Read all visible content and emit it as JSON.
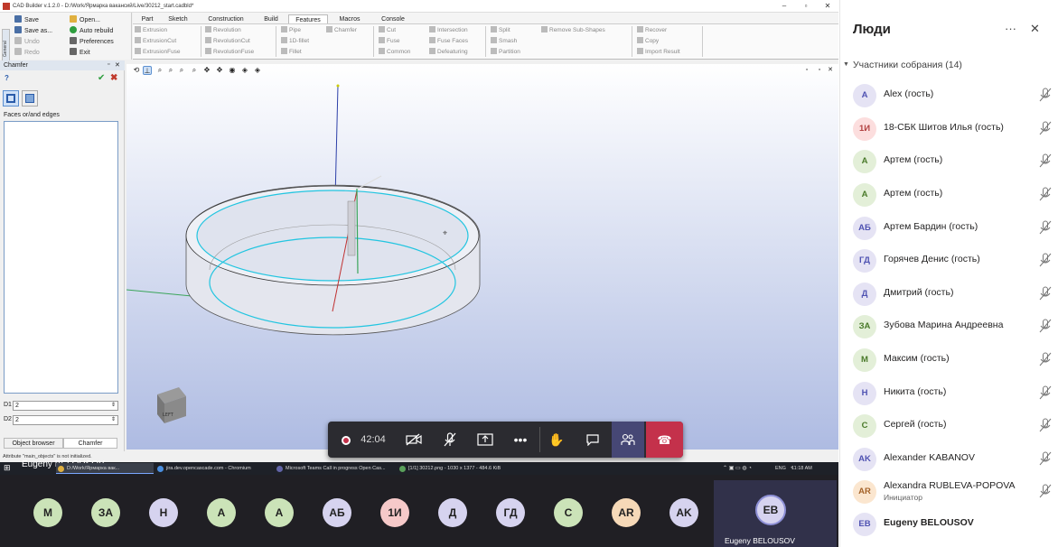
{
  "cad": {
    "title": "CAD Builder v.1.2.0 - D:/Work/Ярмарка вакансий/Live/30212_start.cadbld*",
    "quick": {
      "save": "Save",
      "save_as": "Save as...",
      "undo": "Undo",
      "redo": "Redo",
      "open": "Open...",
      "auto_rebuild": "Auto rebuild",
      "preferences": "Preferences",
      "exit": "Exit",
      "general": "General"
    },
    "tabs": [
      "Part",
      "Sketch",
      "Construction",
      "Build",
      "Features",
      "Macros",
      "Console"
    ],
    "active_tab": "Features",
    "ribbon": {
      "extrusion": "Extrusion",
      "extrusion_cut": "ExtrusionCut",
      "extrusion_fuse": "ExtrusionFuse",
      "revolution": "Revolution",
      "revolution_cut": "RevolutionCut",
      "revolution_fuse": "RevolutionFuse",
      "pipe": "Pipe",
      "fillet_1d": "1D-fillet",
      "fillet": "Fillet",
      "chamfer": "Chamfer",
      "cut": "Cut",
      "fuse": "Fuse",
      "common": "Common",
      "intersection": "Intersection",
      "fuse_faces": "Fuse Faces",
      "defeaturing": "Defeaturing",
      "split": "Split",
      "smash": "Smash",
      "partition": "Partition",
      "remove_subshapes": "Remove Sub-Shapes",
      "recover": "Recover",
      "copy": "Copy",
      "import_result": "Import Result"
    },
    "panel": {
      "title": "Chamfer",
      "help": "?",
      "faces_label": "Faces or/and edges",
      "d1_label": "D1",
      "d1_value": "2",
      "d2_label": "D2",
      "d2_value": "2",
      "tab_object_browser": "Object browser",
      "tab_chamfer": "Chamfer"
    },
    "status": "Attribute \"main_objects\" is not initialized.",
    "cube_label": "LEFT"
  },
  "taskbar": {
    "items": [
      "Eugeny BELOUSOV",
      "D:/Work/Ярмарка вак...",
      "jira.dev.opencascade.com - Chromium",
      "Microsoft Teams Call in progress  Open Cas...",
      "[1/1] 30212.png - 1030 x 1377 - 484.6 KiB"
    ],
    "lang": "ENG",
    "time": "11:18 AM"
  },
  "call": {
    "timer": "42:04",
    "avatars": [
      "М",
      "ЗА",
      "Н",
      "А",
      "А",
      "АБ",
      "1И",
      "Д",
      "ГД",
      "С",
      "AR",
      "AK"
    ],
    "me_initials": "EB",
    "me_name": "Eugeny BELOUSOV"
  },
  "side": {
    "title": "Люди",
    "section": "Участники собрания (14)",
    "people": [
      {
        "initials": "A",
        "name": "Alex (гость)",
        "color": "#e5e3f4",
        "fg": "#4f52b2"
      },
      {
        "initials": "1И",
        "name": "18-СБК Шитов Илья (гость)",
        "color": "#fcdede",
        "fg": "#b24242"
      },
      {
        "initials": "А",
        "name": "Артем (гость)",
        "color": "#e3efd8",
        "fg": "#4a7a2a"
      },
      {
        "initials": "А",
        "name": "Артем (гость)",
        "color": "#e3efd8",
        "fg": "#4a7a2a"
      },
      {
        "initials": "АБ",
        "name": "Артем Бардин (гость)",
        "color": "#e5e3f4",
        "fg": "#4f52b2"
      },
      {
        "initials": "ГД",
        "name": "Горячев Денис (гость)",
        "color": "#e5e3f4",
        "fg": "#4f52b2"
      },
      {
        "initials": "Д",
        "name": "Дмитрий (гость)",
        "color": "#e5e3f4",
        "fg": "#4f52b2"
      },
      {
        "initials": "ЗА",
        "name": "Зубова Марина Андреевна",
        "color": "#e3efd8",
        "fg": "#4a7a2a"
      },
      {
        "initials": "М",
        "name": "Максим (гость)",
        "color": "#e3efd8",
        "fg": "#4a7a2a"
      },
      {
        "initials": "Н",
        "name": "Никита (гость)",
        "color": "#e5e3f4",
        "fg": "#4f52b2"
      },
      {
        "initials": "С",
        "name": "Сергей (гость)",
        "color": "#e3efd8",
        "fg": "#4a7a2a"
      },
      {
        "initials": "AK",
        "name": "Alexander KABANOV",
        "color": "#e5e3f4",
        "fg": "#4f52b2"
      },
      {
        "initials": "AR",
        "name": "Alexandra RUBLEVA-POPOVA",
        "color": "#fbe6cf",
        "fg": "#a4632a"
      },
      {
        "initials": "EB",
        "name": "Eugeny BELOUSOV",
        "color": "#e5e3f4",
        "fg": "#4f52b2"
      }
    ],
    "organizer_role": "Инициатор"
  },
  "colors": {
    "teams_bar": "#2b2b30",
    "hangup": "#c4314b",
    "strip_bg": "#201f24",
    "active_ctrl": "#464775"
  }
}
